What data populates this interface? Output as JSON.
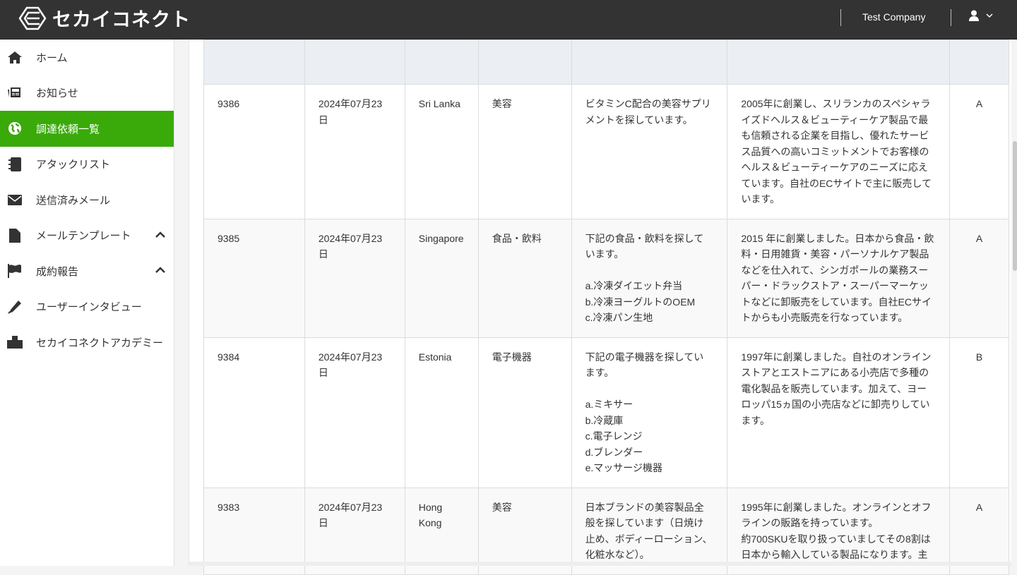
{
  "header": {
    "brand": "セカイコネクト",
    "company": "Test Company"
  },
  "sidebar": {
    "items": [
      {
        "label": "ホーム",
        "icon": "home-icon"
      },
      {
        "label": "お知らせ",
        "icon": "newspaper-icon"
      },
      {
        "label": "調達依頼一覧",
        "icon": "globe-icon",
        "active": true
      },
      {
        "label": "アタックリスト",
        "icon": "notebook-icon"
      },
      {
        "label": "送信済みメール",
        "icon": "envelope-icon"
      },
      {
        "label": "メールテンプレート",
        "icon": "file-icon",
        "expand": true
      },
      {
        "label": "成約報告",
        "icon": "flag-icon",
        "expand": true
      },
      {
        "label": "ユーザーインタビュー",
        "icon": "pencil-icon"
      },
      {
        "label": "セカイコネクトアカデミー",
        "icon": "building-icon"
      }
    ]
  },
  "table": {
    "rows": [
      {
        "id": "9386",
        "date": "2024年07月23\n日",
        "country": "Sri Lanka",
        "category": "美容",
        "request": "ビタミンC配合の美容サプリ\nメントを探しています。",
        "company": "2005年に創業し、スリランカのスペシャラ\nイズドヘルス＆ビューティーケア製品で最\nも信頼される企業を目指し、優れたサービ\nス品質への高いコミットメントでお客様の\nヘルス＆ビューティーケアのニーズに応え\nています。自社のECサイトで主に販売して\nいます。",
        "rank": "A"
      },
      {
        "id": "9385",
        "date": "2024年07月23\n日",
        "country": "Singapore",
        "category": "食品・飲料",
        "request": "下記の食品・飲料を探して\nいます。\n\na.冷凍ダイエット弁当\nb.冷凍ヨーグルトのOEM\nc.冷凍パン生地",
        "company": "2015 年に創業しました。日本から食品・飲\n料・日用雑貨・美容・パーソナルケア製品\nなどを仕入れて、シンガポールの業務スー\nパー・ドラックストア・スーパーマーケッ\nトなどに卸販売をしています。自社ECサイ\nトからも小売販売を行なっています。",
        "rank": "A"
      },
      {
        "id": "9384",
        "date": "2024年07月23\n日",
        "country": "Estonia",
        "category": "電子機器",
        "request": "下記の電子機器を探してい\nます。\n\na.ミキサー\nb.冷蔵庫\nc.電子レンジ\nd.ブレンダー\ne.マッサージ機器",
        "company": "1997年に創業しました。自社のオンライン\nストアとエストニアにある小売店で多種の\n電化製品を販売しています。加えて、ヨー\nロッパ15ヵ国の小売店などに卸売りしてい\nます。",
        "rank": "B"
      },
      {
        "id": "9383",
        "date": "2024年07月23\n日",
        "country": "Hong\nKong",
        "category": "美容",
        "request": "日本ブランドの美容製品全\n般を探しています（日焼け\n止め、ボディーローション、\n化粧水など）。",
        "company": "1995年に創業しました。オンラインとオフ\nラインの販路を持っています。\n約700SKUを取り扱っていましてその8割は\n日本から輸入している製品になります。主",
        "rank": "A"
      }
    ]
  }
}
